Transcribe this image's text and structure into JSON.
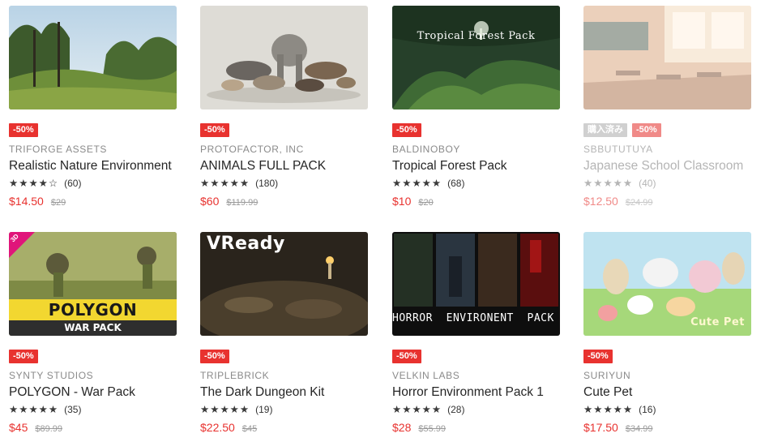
{
  "products": [
    {
      "publisher": "TRIFORGE ASSETS",
      "title": "Realistic Nature Environment",
      "rating": 4,
      "reviews": "(60)",
      "price": "$14.50",
      "old_price": "$29",
      "discount": "-50%",
      "overlay_text": ""
    },
    {
      "publisher": "PROTOFACTOR, INC",
      "title": "ANIMALS FULL PACK",
      "rating": 5,
      "reviews": "(180)",
      "price": "$60",
      "old_price": "$119.99",
      "discount": "-50%",
      "overlay_text": ""
    },
    {
      "publisher": "BALDINOBOY",
      "title": "Tropical Forest Pack",
      "rating": 5,
      "reviews": "(68)",
      "price": "$10",
      "old_price": "$20",
      "discount": "-50%",
      "overlay_text": "Tropical Forest Pack"
    },
    {
      "publisher": "SBBUTUTUYA",
      "title": "Japanese School Classroom",
      "rating": 5,
      "reviews": "(40)",
      "price": "$12.50",
      "old_price": "$24.99",
      "discount": "-50%",
      "owned": "購入済み",
      "overlay_text": ""
    },
    {
      "publisher": "SYNTY STUDIOS",
      "title": "POLYGON - War Pack",
      "rating": 5,
      "reviews": "(35)",
      "price": "$45",
      "old_price": "$89.99",
      "discount": "-50%",
      "overlay_text": "POLYGON",
      "overlay_sub": "WAR PACK",
      "corner_tag": "3D"
    },
    {
      "publisher": "TRIPLEBRICK",
      "title": "The Dark Dungeon Kit",
      "rating": 5,
      "reviews": "(19)",
      "price": "$22.50",
      "old_price": "$45",
      "discount": "-50%",
      "overlay_text": "VReady"
    },
    {
      "publisher": "VELKIN LABS",
      "title": "Horror Environment Pack 1",
      "rating": 5,
      "reviews": "(28)",
      "price": "$28",
      "old_price": "$55.99",
      "discount": "-50%",
      "overlay_text": "HORROR  ENVIRONENT  PACK  I"
    },
    {
      "publisher": "SURIYUN",
      "title": "Cute Pet",
      "rating": 5,
      "reviews": "(16)",
      "price": "$17.50",
      "old_price": "$34.99",
      "discount": "-50%",
      "overlay_text": "Cute Pet"
    }
  ],
  "colors": {
    "discount": "#e8322f",
    "price": "#e8322f",
    "owned": "#bdbdbd"
  },
  "icons": {
    "star_full": "star-icon",
    "star_empty": "star-outline-icon"
  }
}
